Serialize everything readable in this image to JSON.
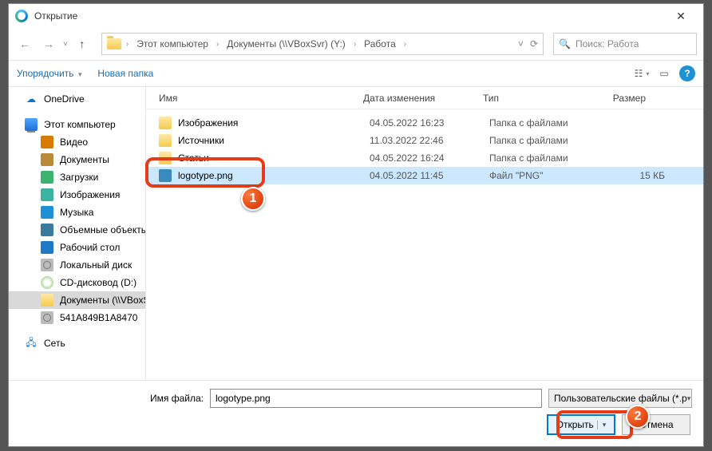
{
  "titlebar": {
    "title": "Открытие"
  },
  "path": {
    "segments": [
      "Этот компьютер",
      "Документы (\\\\VBoxSvr) (Y:)",
      "Работа"
    ]
  },
  "search": {
    "placeholder": "Поиск: Работа"
  },
  "toolbar": {
    "organize": "Упорядочить",
    "newfolder": "Новая папка"
  },
  "columns": {
    "name": "Имя",
    "date": "Дата изменения",
    "type": "Тип",
    "size": "Размер"
  },
  "sidebar_top": {
    "onedrive": "OneDrive",
    "thispc": "Этот компьютер"
  },
  "sidebar_items": [
    {
      "label": "Видео",
      "icon": "ico-vid"
    },
    {
      "label": "Документы",
      "icon": "ico-doc"
    },
    {
      "label": "Загрузки",
      "icon": "ico-dl"
    },
    {
      "label": "Изображения",
      "icon": "ico-img"
    },
    {
      "label": "Музыка",
      "icon": "ico-mus"
    },
    {
      "label": "Объемные объекты",
      "icon": "ico-3d"
    },
    {
      "label": "Рабочий стол",
      "icon": "ico-desk"
    },
    {
      "label": "Локальный диск",
      "icon": "ico-disk"
    },
    {
      "label": "CD-дисковод (D:)",
      "icon": "ico-cd"
    },
    {
      "label": "Документы (\\\\VBoxSvr)",
      "icon": "ico-fold",
      "selected": true
    },
    {
      "label": "541A849B1A8470",
      "icon": "ico-disk"
    }
  ],
  "sidebar_network": "Сеть",
  "files": [
    {
      "name": "Изображения",
      "date": "04.05.2022 16:23",
      "type": "Папка с файлами",
      "size": "",
      "icon": "ico-fold"
    },
    {
      "name": "Источники",
      "date": "11.03.2022 22:46",
      "type": "Папка с файлами",
      "size": "",
      "icon": "ico-fold"
    },
    {
      "name": "Статьи",
      "date": "04.05.2022 16:24",
      "type": "Папка с файлами",
      "size": "",
      "icon": "ico-fold"
    },
    {
      "name": "logotype.png",
      "date": "04.05.2022 11:45",
      "type": "Файл \"PNG\"",
      "size": "15 КБ",
      "icon": "ico-png",
      "selected": true
    }
  ],
  "footer": {
    "filename_label": "Имя файла:",
    "filename_value": "logotype.png",
    "filter": "Пользовательские файлы (*.p",
    "open": "Открыть",
    "cancel": "Отмена"
  },
  "annotations": {
    "badge1": "1",
    "badge2": "2"
  }
}
